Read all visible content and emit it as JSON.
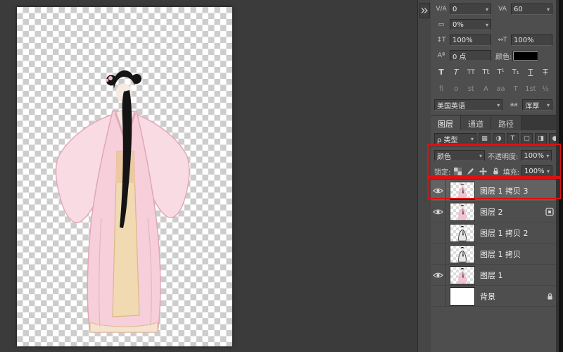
{
  "character_panel": {
    "kerning_icon": "V∕A",
    "kerning_value": "0",
    "tracking_icon": "VA",
    "tracking_value": "60",
    "spacing_icon": "▭",
    "spacing_value": "0%",
    "vscale_icon": "↕T",
    "vscale_value": "100%",
    "hscale_icon": "↔T",
    "hscale_value": "100%",
    "baseline_icon": "Aª",
    "baseline_value": "0 点",
    "color_label": "颜色:",
    "color_value": "#000000",
    "style_buttons": [
      "T",
      "T",
      "TT",
      "Tt",
      "T¹",
      "T₁",
      "T",
      "T"
    ],
    "opentype_buttons": [
      "fi",
      "o",
      "st",
      "A",
      "aa",
      "T",
      "1st",
      "½"
    ],
    "language_value": "美国英语",
    "aa_icon": "aa",
    "aa_value": "浑厚"
  },
  "layers_panel": {
    "tabs": [
      "图层",
      "通道",
      "路径"
    ],
    "kind_icon": "ρ",
    "kind_label": "类型",
    "filter_icons": [
      "▦",
      "◑",
      "T",
      "▢",
      "◨"
    ],
    "filter_toggle_icon": "●",
    "blend_mode_value": "颜色",
    "opacity_label": "不透明度:",
    "opacity_value": "100%",
    "lock_label": "锁定:",
    "fill_label": "填充:",
    "fill_value": "100%",
    "layers": [
      {
        "name": "图层 1 拷贝 3",
        "visible": true,
        "selected": true,
        "thumb": "pink",
        "badge": "none"
      },
      {
        "name": "图层 2",
        "visible": true,
        "selected": false,
        "thumb": "pink",
        "badge": "style"
      },
      {
        "name": "图层 1 拷贝 2",
        "visible": false,
        "selected": false,
        "thumb": "dark",
        "badge": "none"
      },
      {
        "name": "图层 1 拷贝",
        "visible": false,
        "selected": false,
        "thumb": "dark",
        "badge": "none"
      },
      {
        "name": "图层 1",
        "visible": true,
        "selected": false,
        "thumb": "pink",
        "badge": "none"
      },
      {
        "name": "背景",
        "visible": false,
        "selected": false,
        "thumb": "white",
        "badge": "lock"
      }
    ]
  },
  "annotation_color": "#dd1111"
}
